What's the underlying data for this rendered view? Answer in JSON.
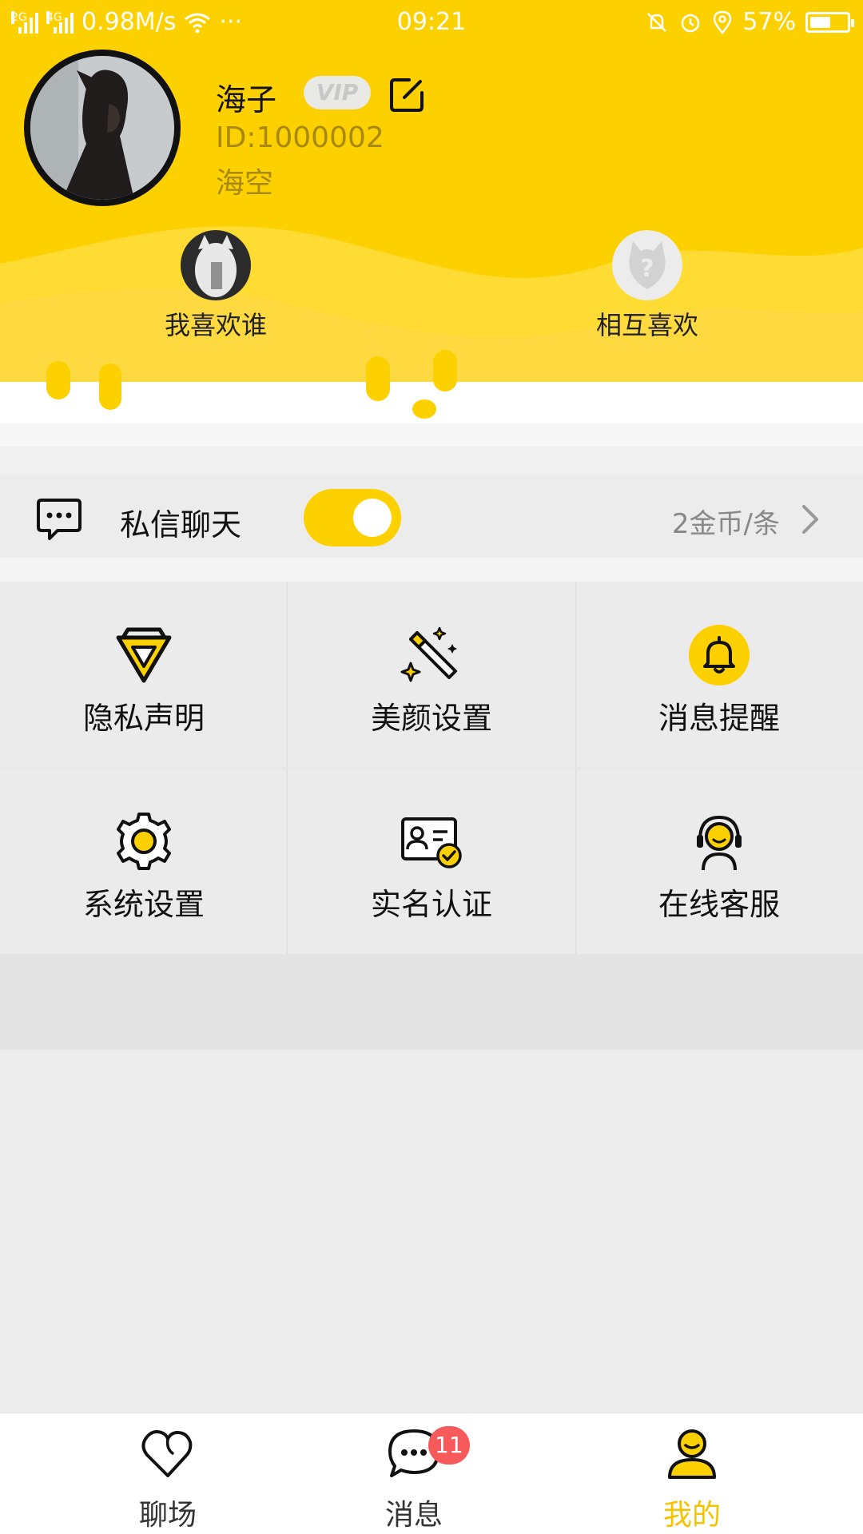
{
  "status_bar": {
    "net_speed": "0.98M/s",
    "more": "···",
    "time": "09:21",
    "battery_percent": "57%",
    "battery_level": 0.57,
    "signal_tags": [
      "2G",
      "4G"
    ]
  },
  "profile": {
    "name": "海子",
    "vip_label": "VIP",
    "id_text": "ID:1000002",
    "signature": "海空",
    "avatar_icon": "avatar-photo"
  },
  "likes": {
    "i_like_label": "我喜欢谁",
    "mutual_label": "相互喜欢"
  },
  "chat_setting": {
    "title": "私信聊天",
    "price": "2金币/条",
    "enabled": true
  },
  "grid_items": [
    {
      "label": "隐私声明",
      "icon": "diamond-icon"
    },
    {
      "label": "美颜设置",
      "icon": "magic-wand-icon"
    },
    {
      "label": "消息提醒",
      "icon": "bell-icon"
    },
    {
      "label": "系统设置",
      "icon": "gear-icon"
    },
    {
      "label": "实名认证",
      "icon": "id-card-icon"
    },
    {
      "label": "在线客服",
      "icon": "headset-icon"
    }
  ],
  "tabbar": {
    "tabs": [
      {
        "label": "聊场",
        "icon": "heart-icon"
      },
      {
        "label": "消息",
        "icon": "chat-bubble-icon",
        "badge": "11"
      },
      {
        "label": "我的",
        "icon": "user-icon",
        "active": true
      }
    ]
  },
  "colors": {
    "accent": "#fdd000",
    "badge": "#f75a5a",
    "active_tab": "#f5c400"
  }
}
